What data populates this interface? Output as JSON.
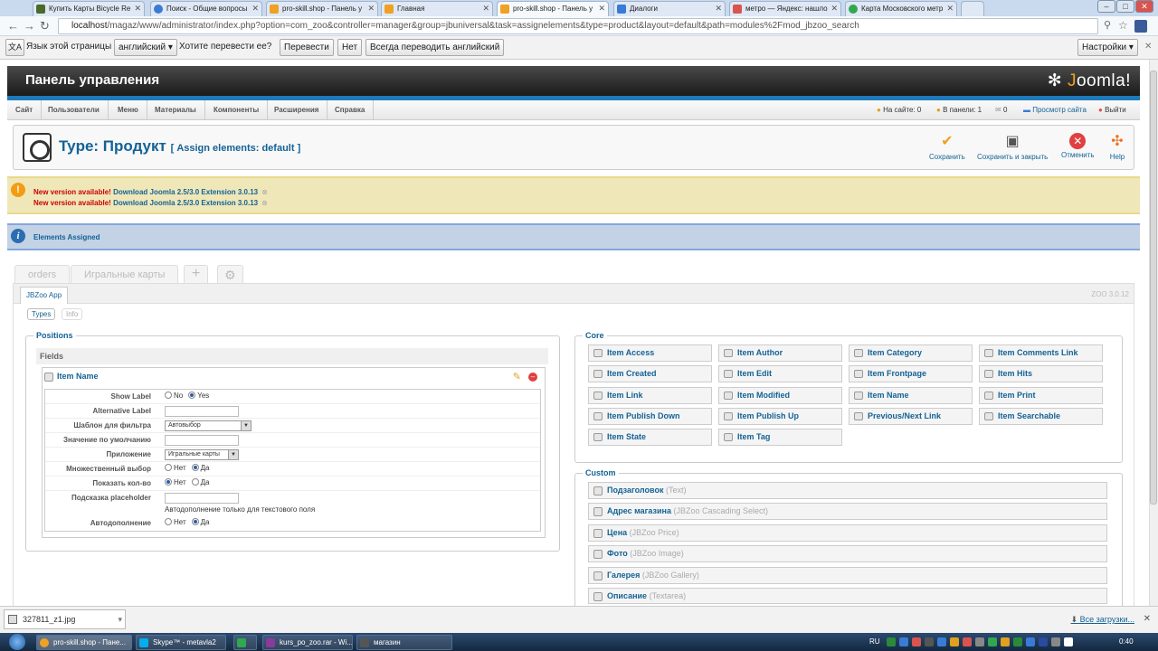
{
  "browser": {
    "tabs": [
      {
        "label": "Купить Карты Bicycle Re",
        "color": "#4a6a2a"
      },
      {
        "label": "Поиск - Общие вопросы",
        "color": "#3a7bd5"
      },
      {
        "label": "pro-skill.shop - Панель у",
        "color": "#f0a023"
      },
      {
        "label": "Главная",
        "color": "#f0a023"
      },
      {
        "label": "pro-skill.shop - Панель у",
        "color": "#f0a023"
      },
      {
        "label": "Диалоги",
        "color": "#3a7bd5"
      },
      {
        "label": "метро — Яндекс: нашло",
        "color": "#d9534f"
      },
      {
        "label": "Карта Московского метр",
        "color": "#2fa84f"
      }
    ],
    "url_host": "localhost",
    "url_rest": "/magaz/www/administrator/index.php?option=com_zoo&controller=manager&group=jbuniversal&task=assignelements&type=product&layout=default&path=modules%2Fmod_jbzoo_search"
  },
  "translate_bar": {
    "label": "Язык этой страницы",
    "language": "английский",
    "question": "Хотите перевести ее?",
    "translate": "Перевести",
    "no": "Нет",
    "always": "Всегда переводить английский",
    "settings": "Настройки"
  },
  "header": {
    "title": "Панель управления",
    "logo_j": "J",
    "logo_rest": "oomla!"
  },
  "menu": {
    "items": [
      "Сайт",
      "Пользователи",
      "Меню",
      "Материалы",
      "Компоненты",
      "Расширения",
      "Справка"
    ],
    "status": {
      "on_site": "На сайте: 0",
      "in_panel": "В панели: 1",
      "messages": "0",
      "view_site": "Просмотр сайта",
      "logout": "Выйти"
    }
  },
  "toolbar": {
    "title": "Type: Продукт",
    "subtitle": "[ Assign elements: default ]",
    "save": "Сохранить",
    "save_close": "Сохранить и закрыть",
    "cancel": "Отменить",
    "help": "Help"
  },
  "warnings": [
    {
      "text": "New version available!",
      "link": "Download Joomla 2.5/3.0 Extension 3.0.13"
    },
    {
      "text": "New version available!",
      "link": "Download Joomla 2.5/3.0 Extension 3.0.13"
    }
  ],
  "info_message": "Elements Assigned",
  "zoo": {
    "tabs": [
      "orders",
      "Игральные карты"
    ],
    "add_tab": "+",
    "settings_tab": "⚙",
    "app_tab": "JBZoo App",
    "version": "ZOO 3.0.12",
    "pill_types": "Types",
    "pill_info": "Info"
  },
  "positions": {
    "legend": "Positions",
    "fields_label": "Fields",
    "element_name": "Item Name",
    "params": [
      {
        "label": "Show Label",
        "kind": "radio",
        "options": [
          "No",
          "Yes"
        ],
        "selected": 1
      },
      {
        "label": "Alternative Label",
        "kind": "input"
      },
      {
        "label": "Шаблон для фильтра",
        "kind": "select",
        "value": "Автовыбор"
      },
      {
        "label": "Значение по умолчанию",
        "kind": "input"
      },
      {
        "label": "Приложение",
        "kind": "select",
        "value": "Игральные карты"
      },
      {
        "label": "Множественный выбор",
        "kind": "radio",
        "options": [
          "Нет",
          "Да"
        ],
        "selected": 1
      },
      {
        "label": "Показать кол-во",
        "kind": "radio",
        "options": [
          "Нет",
          "Да"
        ],
        "selected": 0
      },
      {
        "label": "Подсказка placeholder",
        "kind": "input"
      },
      {
        "label": "",
        "kind": "note",
        "value": "Автодополнение только для текстового поля"
      },
      {
        "label": "Автодополнение",
        "kind": "radio",
        "options": [
          "Нет",
          "Да"
        ],
        "selected": 1
      }
    ]
  },
  "core": {
    "legend": "Core",
    "items": [
      "Item Access",
      "Item Author",
      "Item Category",
      "Item Comments Link",
      "Item Created",
      "Item Edit",
      "Item Frontpage",
      "Item Hits",
      "Item Link",
      "Item Modified",
      "Item Name",
      "Item Print",
      "Item Publish Down",
      "Item Publish Up",
      "Previous/Next Link",
      "Item Searchable",
      "Item State",
      "Item Tag"
    ]
  },
  "custom": {
    "legend": "Custom",
    "items": [
      {
        "name": "Подзаголовок",
        "type": "(Text)"
      },
      {
        "name": "Адрес магазина",
        "type": "(JBZoo Cascading Select)"
      },
      {
        "name": "Цена",
        "type": "(JBZoo Price)"
      },
      {
        "name": "Фото",
        "type": "(JBZoo Image)"
      },
      {
        "name": "Галерея",
        "type": "(JBZoo Gallery)"
      },
      {
        "name": "Описание",
        "type": "(Textarea)"
      }
    ]
  },
  "download_bar": {
    "file": "327811_z1.jpg",
    "all": "Все загрузки..."
  },
  "taskbar": {
    "items": [
      {
        "label": "pro-skill.shop - Пане...",
        "color": "#f0a023"
      },
      {
        "label": "Skype™ - metavla2",
        "color": "#00aff0"
      },
      {
        "label": "",
        "color": "#2fa84f"
      },
      {
        "label": "kurs_po_zoo.rar - Wi...",
        "color": "#8a3a9a"
      },
      {
        "label": "магазин",
        "color": "#555555"
      }
    ],
    "lang": "RU",
    "clock": "0:40"
  }
}
